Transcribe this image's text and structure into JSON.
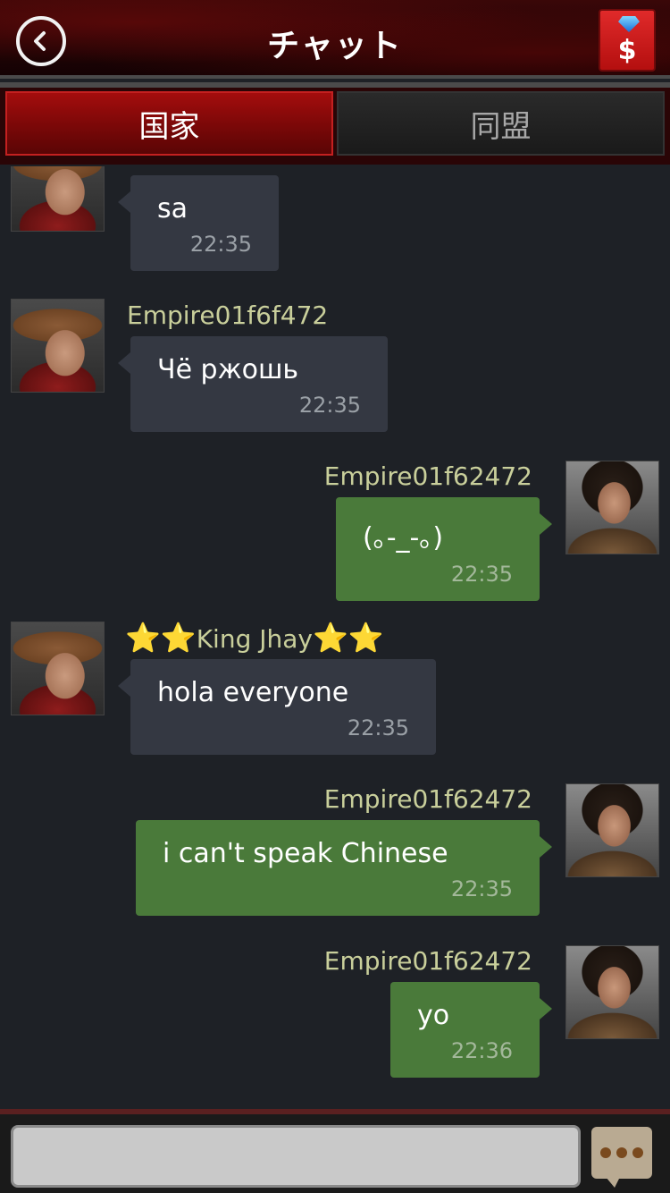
{
  "header": {
    "title": "チャット",
    "store_symbol": "$"
  },
  "tabs": [
    {
      "label": "国家",
      "active": true
    },
    {
      "label": "同盟",
      "active": false
    }
  ],
  "messages": [
    {
      "side": "left",
      "avatar": "cowboy-avatar",
      "name": "",
      "text": "sa",
      "time": "22:35"
    },
    {
      "side": "left",
      "avatar": "cowboy-avatar",
      "name": "Empire01f6f472",
      "text": "Чё ржошь",
      "time": "22:35"
    },
    {
      "side": "right",
      "avatar": "survivor-avatar",
      "name": "Empire01f62472",
      "text": "(｡-_-｡)",
      "time": "22:35"
    },
    {
      "side": "left",
      "avatar": "cowboy-avatar",
      "name": "King Jhay",
      "name_stars": "⭐⭐",
      "text": "hola everyone",
      "time": "22:35"
    },
    {
      "side": "right",
      "avatar": "survivor-avatar",
      "name": "Empire01f62472",
      "text": "i can't speak Chinese",
      "time": "22:35"
    },
    {
      "side": "right",
      "avatar": "survivor-avatar",
      "name": "Empire01f62472",
      "text": "yo",
      "time": "22:36"
    }
  ],
  "input": {
    "value": "",
    "placeholder": ""
  },
  "colors": {
    "header_bg": "#2a0506",
    "tab_active": "#a40d0d",
    "bubble_left": "#343842",
    "bubble_right": "#4a7a3a",
    "name_color": "#c9cf9b"
  }
}
